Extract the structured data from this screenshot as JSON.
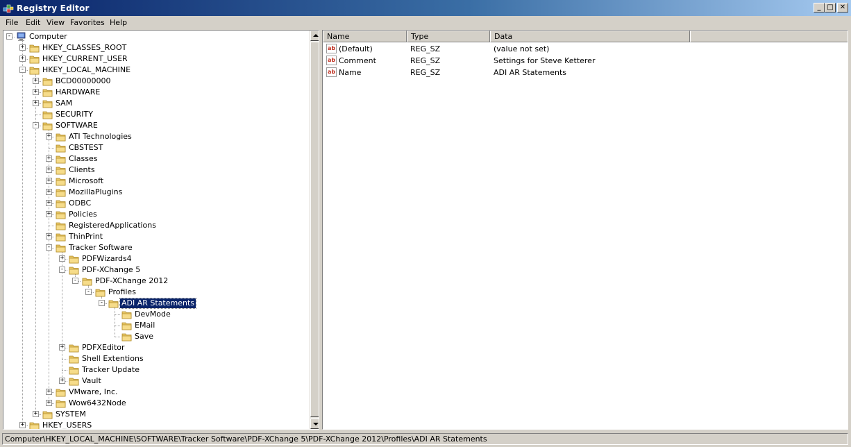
{
  "window": {
    "title": "Registry Editor",
    "minimize_glyph": "_",
    "maximize_glyph": "□",
    "close_glyph": "✕"
  },
  "menu": [
    "File",
    "Edit",
    "View",
    "Favorites",
    "Help"
  ],
  "tree": [
    {
      "label": "Computer",
      "depth": 0,
      "expander": "-",
      "icon": "computer-icon"
    },
    {
      "label": "HKEY_CLASSES_ROOT",
      "depth": 1,
      "expander": "+"
    },
    {
      "label": "HKEY_CURRENT_USER",
      "depth": 1,
      "expander": "+"
    },
    {
      "label": "HKEY_LOCAL_MACHINE",
      "depth": 1,
      "expander": "-"
    },
    {
      "label": "BCD00000000",
      "depth": 2,
      "expander": "+"
    },
    {
      "label": "HARDWARE",
      "depth": 2,
      "expander": "+"
    },
    {
      "label": "SAM",
      "depth": 2,
      "expander": "+"
    },
    {
      "label": "SECURITY",
      "depth": 2,
      "expander": ""
    },
    {
      "label": "SOFTWARE",
      "depth": 2,
      "expander": "-"
    },
    {
      "label": "ATI Technologies",
      "depth": 3,
      "expander": "+"
    },
    {
      "label": "CBSTEST",
      "depth": 3,
      "expander": ""
    },
    {
      "label": "Classes",
      "depth": 3,
      "expander": "+"
    },
    {
      "label": "Clients",
      "depth": 3,
      "expander": "+"
    },
    {
      "label": "Microsoft",
      "depth": 3,
      "expander": "+"
    },
    {
      "label": "MozillaPlugins",
      "depth": 3,
      "expander": "+"
    },
    {
      "label": "ODBC",
      "depth": 3,
      "expander": "+"
    },
    {
      "label": "Policies",
      "depth": 3,
      "expander": "+"
    },
    {
      "label": "RegisteredApplications",
      "depth": 3,
      "expander": ""
    },
    {
      "label": "ThinPrint",
      "depth": 3,
      "expander": "+"
    },
    {
      "label": "Tracker Software",
      "depth": 3,
      "expander": "-"
    },
    {
      "label": "PDFWizards4",
      "depth": 4,
      "expander": "+"
    },
    {
      "label": "PDF-XChange 5",
      "depth": 4,
      "expander": "-"
    },
    {
      "label": "PDF-XChange 2012",
      "depth": 5,
      "expander": "-"
    },
    {
      "label": "Profiles",
      "depth": 6,
      "expander": "-"
    },
    {
      "label": "ADI AR Statements",
      "depth": 7,
      "expander": "-",
      "selected": true
    },
    {
      "label": "DevMode",
      "depth": 8,
      "expander": ""
    },
    {
      "label": "EMail",
      "depth": 8,
      "expander": ""
    },
    {
      "label": "Save",
      "depth": 8,
      "expander": ""
    },
    {
      "label": "PDFXEditor",
      "depth": 4,
      "expander": "+"
    },
    {
      "label": "Shell Extentions",
      "depth": 4,
      "expander": ""
    },
    {
      "label": "Tracker Update",
      "depth": 4,
      "expander": ""
    },
    {
      "label": "Vault",
      "depth": 4,
      "expander": "+"
    },
    {
      "label": "VMware, Inc.",
      "depth": 3,
      "expander": "+"
    },
    {
      "label": "Wow6432Node",
      "depth": 3,
      "expander": "+"
    },
    {
      "label": "SYSTEM",
      "depth": 2,
      "expander": "+"
    },
    {
      "label": "HKEY_USERS",
      "depth": 1,
      "expander": "+"
    }
  ],
  "list": {
    "columns": [
      "Name",
      "Type",
      "Data"
    ],
    "rows": [
      {
        "icon": "ab",
        "name": "(Default)",
        "type": "REG_SZ",
        "data": "(value not set)"
      },
      {
        "icon": "ab",
        "name": "Comment",
        "type": "REG_SZ",
        "data": "Settings for Steve Ketterer"
      },
      {
        "icon": "ab",
        "name": "Name",
        "type": "REG_SZ",
        "data": "ADI AR Statements"
      }
    ]
  },
  "status": "Computer\\HKEY_LOCAL_MACHINE\\SOFTWARE\\Tracker Software\\PDF-XChange 5\\PDF-XChange 2012\\Profiles\\ADI AR Statements"
}
